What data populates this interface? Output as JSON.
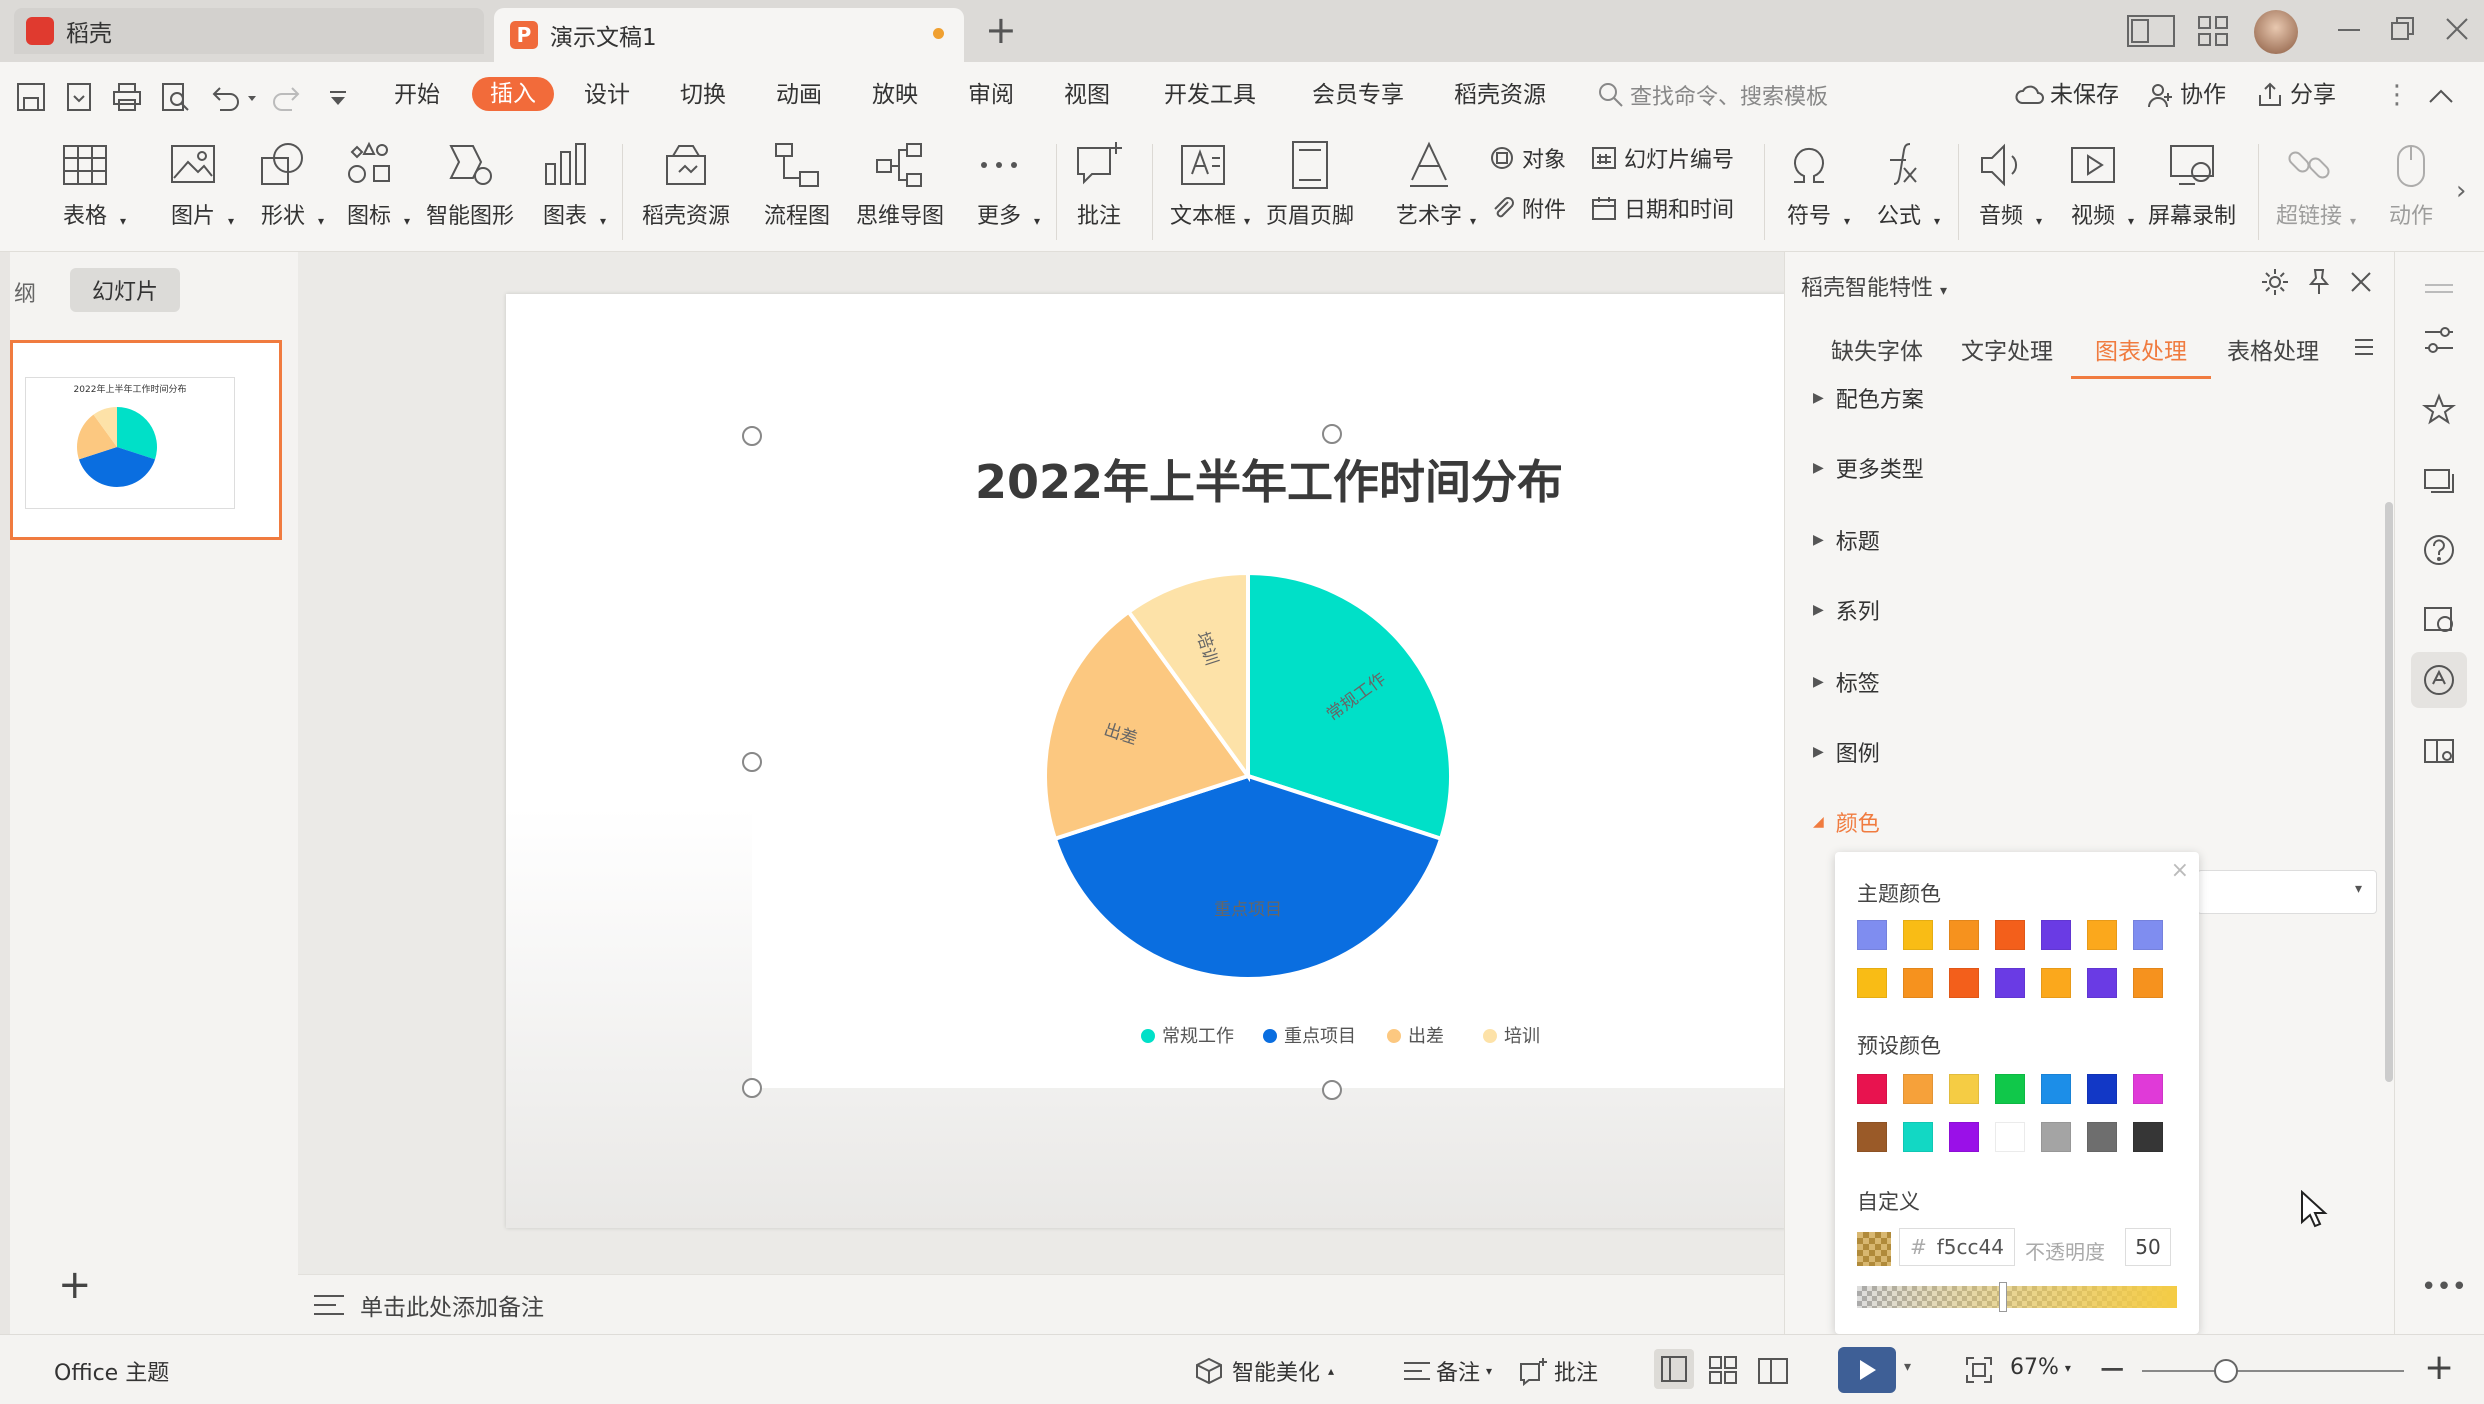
{
  "titlebar": {
    "app_tab": "稻壳",
    "doc_tab": "演示文稿1",
    "add_tab": "+"
  },
  "menu": {
    "items": [
      "开始",
      "插入",
      "设计",
      "切换",
      "动画",
      "放映",
      "审阅",
      "视图",
      "开发工具",
      "会员专享",
      "稻壳资源"
    ],
    "active": "插入",
    "search_placeholder": "查找命令、搜索模板",
    "unsaved": "未保存",
    "collab": "协作",
    "share": "分享"
  },
  "ribbon": {
    "big": [
      {
        "label": "表格",
        "arrow": true
      },
      {
        "label": "图片",
        "arrow": true
      },
      {
        "label": "形状",
        "arrow": true
      },
      {
        "label": "图标",
        "arrow": true
      },
      {
        "label": "智能图形"
      },
      {
        "label": "图表",
        "arrow": true
      },
      {
        "label": "稻壳资源"
      },
      {
        "label": "流程图"
      },
      {
        "label": "思维导图"
      },
      {
        "label": "更多",
        "arrow": true
      },
      {
        "label": "批注"
      },
      {
        "label": "文本框",
        "arrow": true
      },
      {
        "label": "页眉页脚"
      },
      {
        "label": "艺术字",
        "arrow": true
      },
      {
        "label": "符号",
        "arrow": true
      },
      {
        "label": "公式",
        "arrow": true
      },
      {
        "label": "音频",
        "arrow": true
      },
      {
        "label": "视频",
        "arrow": true
      },
      {
        "label": "屏幕录制"
      },
      {
        "label": "超链接",
        "arrow": true
      },
      {
        "label": "动作"
      }
    ],
    "small": {
      "object": "对象",
      "attachment": "附件",
      "slide_number": "幻灯片编号",
      "date_time": "日期和时间"
    }
  },
  "left_panel": {
    "outline_tab": "大纲",
    "slides_tab": "幻灯片",
    "add": "+"
  },
  "notes": {
    "placeholder": "单击此处添加备注"
  },
  "chart_data": {
    "type": "pie",
    "title": "2022年上半年工作时间分布",
    "categories": [
      "常规工作",
      "重点项目",
      "出差",
      "培训"
    ],
    "values": [
      30,
      40,
      20,
      10
    ],
    "colors": [
      "#00e0c8",
      "#0a6ee0",
      "#fcc880",
      "#fde2a8"
    ],
    "legend": "bottom"
  },
  "right_panel": {
    "title": "稻壳智能特性",
    "tabs": [
      "缺失字体",
      "文字处理",
      "图表处理",
      "表格处理"
    ],
    "active_tab": "图表处理",
    "sections": [
      "配色方案",
      "更多类型",
      "标题",
      "系列",
      "标签",
      "图例",
      "颜色"
    ],
    "popup": {
      "theme_label": "主题颜色",
      "preset_label": "预设颜色",
      "custom_label": "自定义",
      "theme_colors": [
        "#7f8df0",
        "#f9bc15",
        "#f6921e",
        "#f35f1b",
        "#6a3be4",
        "#fba81c",
        "#7f8df0",
        "#f9bc15",
        "#f6921e",
        "#f35f1b",
        "#6a3be4",
        "#fba81c",
        "#6a3be4",
        "#f6921e"
      ],
      "preset_colors": [
        "#e8134f",
        "#f6a13a",
        "#f5cc44",
        "#10c84a",
        "#1c8ee8",
        "#1238c6",
        "#e03ad8",
        "#9a5a28",
        "#12d8c4",
        "#9a10e8",
        "#ffffff",
        "#a4a4a4",
        "#6e6e6e",
        "#363636"
      ],
      "hex_prefix": "#",
      "hex": "f5cc44",
      "opacity_label": "不透明度",
      "opacity": "50"
    }
  },
  "status": {
    "theme": "Office 主题",
    "beautify": "智能美化",
    "notes": "备注",
    "comments": "批注",
    "zoom": "67%"
  }
}
